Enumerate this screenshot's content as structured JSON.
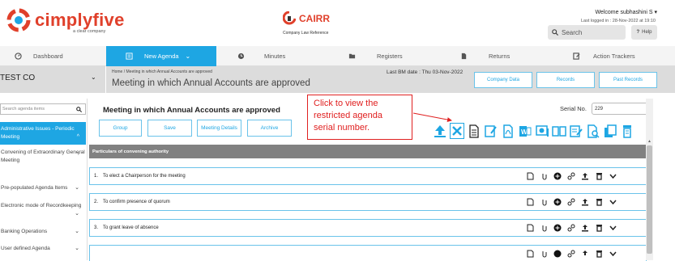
{
  "header": {
    "logo_text": "cimplyfive",
    "logo_sub": "a clear company",
    "cairr_text": "CAIRR",
    "cairr_sub": "Company Law Reference",
    "welcome": "Welcome subhashini  S",
    "last_logged": "Last logged in : 28-Nov-2022 at 19:10",
    "search_placeholder": "Search",
    "help_label": "Help"
  },
  "nav": {
    "items": [
      {
        "label": "Dashboard",
        "icon": "dashboard-icon"
      },
      {
        "label": "New Agenda",
        "icon": "list-icon",
        "active": true
      },
      {
        "label": "Minutes",
        "icon": "clock-icon"
      },
      {
        "label": "Registers",
        "icon": "folder-icon"
      },
      {
        "label": "Returns",
        "icon": "document-icon"
      },
      {
        "label": "Action Trackers",
        "icon": "tracker-icon"
      }
    ]
  },
  "subhead": {
    "company": "TEST CO",
    "breadcrumb": "Home  /  Meeting in which Annual Accounts are approved",
    "title": "Meeting in which Annual Accounts are approved",
    "last_bm": "Last BM date : Thu 03-Nov-2022",
    "buttons": [
      "Company Data",
      "Records",
      "Past Records"
    ]
  },
  "sidebar": {
    "search_placeholder": "Search agenda items",
    "items": [
      {
        "label": "Administrative Issues - Periodic Meeting",
        "active": true
      },
      {
        "label": "Convening of Extraordinary General Meeting"
      },
      {
        "label": "Pre-populated Agenda Items"
      },
      {
        "label": "Electronic mode of Recordkeeping"
      },
      {
        "label": "Banking Operations"
      },
      {
        "label": "User defined Agenda"
      }
    ]
  },
  "main": {
    "meeting_title": "Meeting in which Annual Accounts are approved",
    "tabs": [
      "Group",
      "Save",
      "Meeting Details",
      "Archive"
    ],
    "callout": "Click to view the restricted agenda serial number.",
    "serial_label": "Serial No.",
    "serial_value": "229",
    "section_title": "Particulars of convening authority",
    "agenda_items": [
      {
        "num": "1.",
        "text": "To elect a Chairperson for the meeting"
      },
      {
        "num": "2.",
        "text": "To confirm presence of quorum"
      },
      {
        "num": "3.",
        "text": "To grant leave of absence"
      }
    ]
  },
  "colors": {
    "accent": "#1ea6e3",
    "brand": "#e0402b",
    "callout": "#e02020",
    "section_bar": "#818181"
  }
}
